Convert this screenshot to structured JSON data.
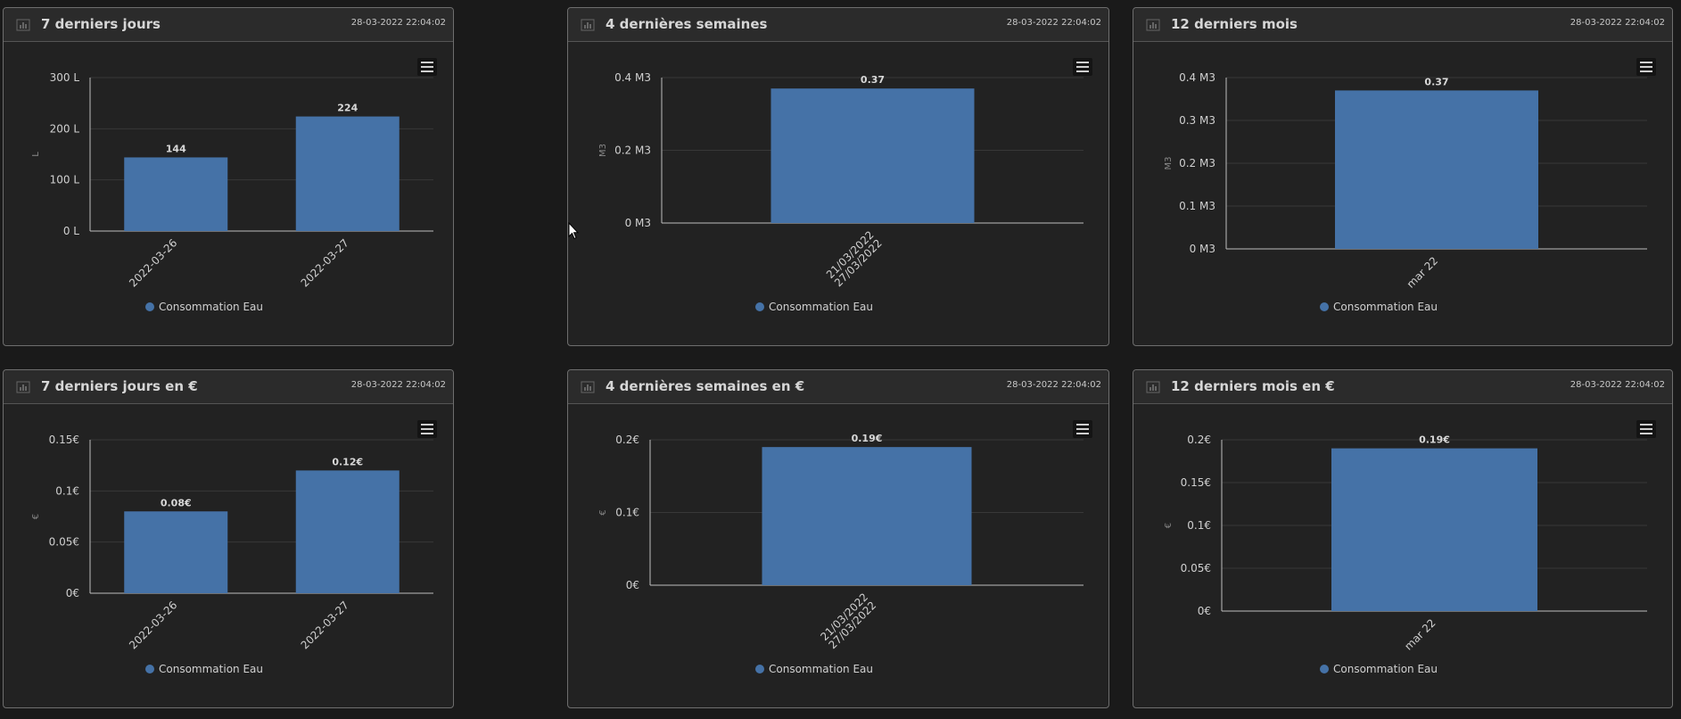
{
  "panels": [
    {
      "id": "p1",
      "title": "7 derniers jours",
      "date": "28-03-2022 22:04:02",
      "chart_data": {
        "type": "bar",
        "title": "7 derniers jours",
        "categories": [
          "2022-03-26",
          "2022-03-27"
        ],
        "series": [
          {
            "name": "Consommation Eau",
            "values": [
              144,
              224
            ]
          }
        ],
        "data_labels": [
          "144",
          "224"
        ],
        "ylabel": "L",
        "ylim": [
          0,
          300
        ],
        "yticks": [
          0,
          100,
          200,
          300
        ],
        "ytick_labels": [
          "0 L",
          "100 L",
          "200 L",
          "300 L"
        ],
        "grid": true,
        "legend": "bottom-center"
      }
    },
    {
      "id": "p2",
      "title": "4 dernières semaines",
      "date": "28-03-2022 22:04:02",
      "chart_data": {
        "type": "bar",
        "title": "4 dernières semaines",
        "categories": [
          "21/03/2022\n27/03/2022"
        ],
        "series": [
          {
            "name": "Consommation Eau",
            "values": [
              0.37
            ]
          }
        ],
        "data_labels": [
          "0.37"
        ],
        "ylabel": "M3",
        "ylim": [
          0,
          0.4
        ],
        "yticks": [
          0,
          0.2,
          0.4
        ],
        "ytick_labels": [
          "0 M3",
          "0.2 M3",
          "0.4 M3"
        ],
        "grid": true,
        "legend": "bottom-center"
      }
    },
    {
      "id": "p3",
      "title": "12 derniers mois",
      "date": "28-03-2022 22:04:02",
      "chart_data": {
        "type": "bar",
        "title": "12 derniers mois",
        "categories": [
          "mar 22"
        ],
        "series": [
          {
            "name": "Consommation Eau",
            "values": [
              0.37
            ]
          }
        ],
        "data_labels": [
          "0.37"
        ],
        "ylabel": "M3",
        "ylim": [
          0,
          0.4
        ],
        "yticks": [
          0,
          0.1,
          0.2,
          0.3,
          0.4
        ],
        "ytick_labels": [
          "0 M3",
          "0.1 M3",
          "0.2 M3",
          "0.3 M3",
          "0.4 M3"
        ],
        "grid": true,
        "legend": "bottom-center"
      }
    },
    {
      "id": "p4",
      "title": "7 derniers jours en €",
      "date": "28-03-2022 22:04:02",
      "chart_data": {
        "type": "bar",
        "title": "7 derniers jours en €",
        "categories": [
          "2022-03-26",
          "2022-03-27"
        ],
        "series": [
          {
            "name": "Consommation Eau",
            "values": [
              0.08,
              0.12
            ]
          }
        ],
        "data_labels": [
          "0.08€",
          "0.12€"
        ],
        "ylabel": "€",
        "ylim": [
          0,
          0.15
        ],
        "yticks": [
          0,
          0.05,
          0.1,
          0.15
        ],
        "ytick_labels": [
          "0€",
          "0.05€",
          "0.1€",
          "0.15€"
        ],
        "grid": true,
        "legend": "bottom-center"
      }
    },
    {
      "id": "p5",
      "title": "4 dernières semaines en €",
      "date": "28-03-2022 22:04:02",
      "chart_data": {
        "type": "bar",
        "title": "4 dernières semaines en €",
        "categories": [
          "21/03/2022\n27/03/2022"
        ],
        "series": [
          {
            "name": "Consommation Eau",
            "values": [
              0.19
            ]
          }
        ],
        "data_labels": [
          "0.19€"
        ],
        "ylabel": "€",
        "ylim": [
          0,
          0.2
        ],
        "yticks": [
          0,
          0.1,
          0.2
        ],
        "ytick_labels": [
          "0€",
          "0.1€",
          "0.2€"
        ],
        "grid": true,
        "legend": "bottom-center"
      }
    },
    {
      "id": "p6",
      "title": "12 derniers mois en €",
      "date": "28-03-2022 22:04:02",
      "chart_data": {
        "type": "bar",
        "title": "12 derniers mois en €",
        "categories": [
          "mar 22"
        ],
        "series": [
          {
            "name": "Consommation Eau",
            "values": [
              0.19
            ]
          }
        ],
        "data_labels": [
          "0.19€"
        ],
        "ylabel": "€",
        "ylim": [
          0,
          0.2
        ],
        "yticks": [
          0,
          0.05,
          0.1,
          0.15,
          0.2
        ],
        "ytick_labels": [
          "0€",
          "0.05€",
          "0.1€",
          "0.15€",
          "0.2€"
        ],
        "grid": true,
        "legend": "bottom-center"
      }
    }
  ],
  "colors": {
    "bar": "#4572a7",
    "panel_bg": "#222222",
    "header_bg": "#2b2b2b",
    "axis": "#bdbdbd",
    "grid": "#383838",
    "text": "#d0d0d0"
  },
  "icons": {
    "header": "bar-chart-icon",
    "menu": "hamburger-menu-icon",
    "cursor": "mouse-pointer-icon"
  }
}
